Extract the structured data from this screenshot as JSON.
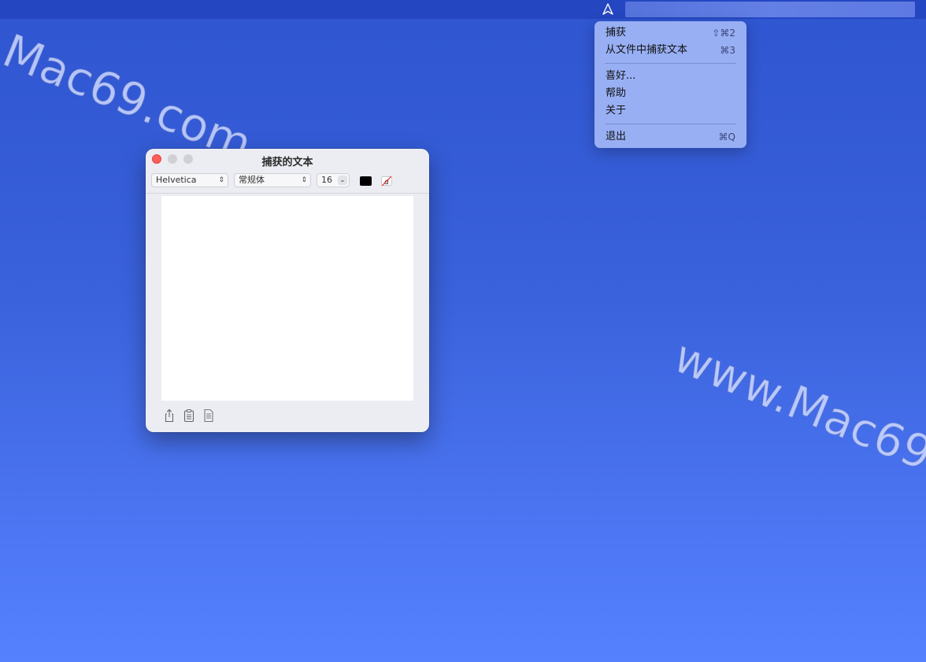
{
  "menubar": {
    "app_icon": "triangle-outline-icon"
  },
  "menu": {
    "items": [
      {
        "label": "捕获",
        "shortcut": "⇧⌘2"
      },
      {
        "label": "从文件中捕获文本",
        "shortcut": "⌘3"
      },
      {
        "label": "喜好...",
        "shortcut": ""
      },
      {
        "label": "帮助",
        "shortcut": ""
      },
      {
        "label": "关于",
        "shortcut": ""
      },
      {
        "label": "退出",
        "shortcut": "⌘Q"
      }
    ]
  },
  "window": {
    "title": "捕获的文本",
    "font_family": "Helvetica",
    "font_style": "常规体",
    "font_size": "16",
    "text_color": "#000000",
    "text_content": "",
    "bottom_icons": [
      "share-icon",
      "clipboard-icon",
      "document-icon"
    ]
  },
  "watermarks": [
    "Mac69.com",
    "www.Mac69"
  ]
}
